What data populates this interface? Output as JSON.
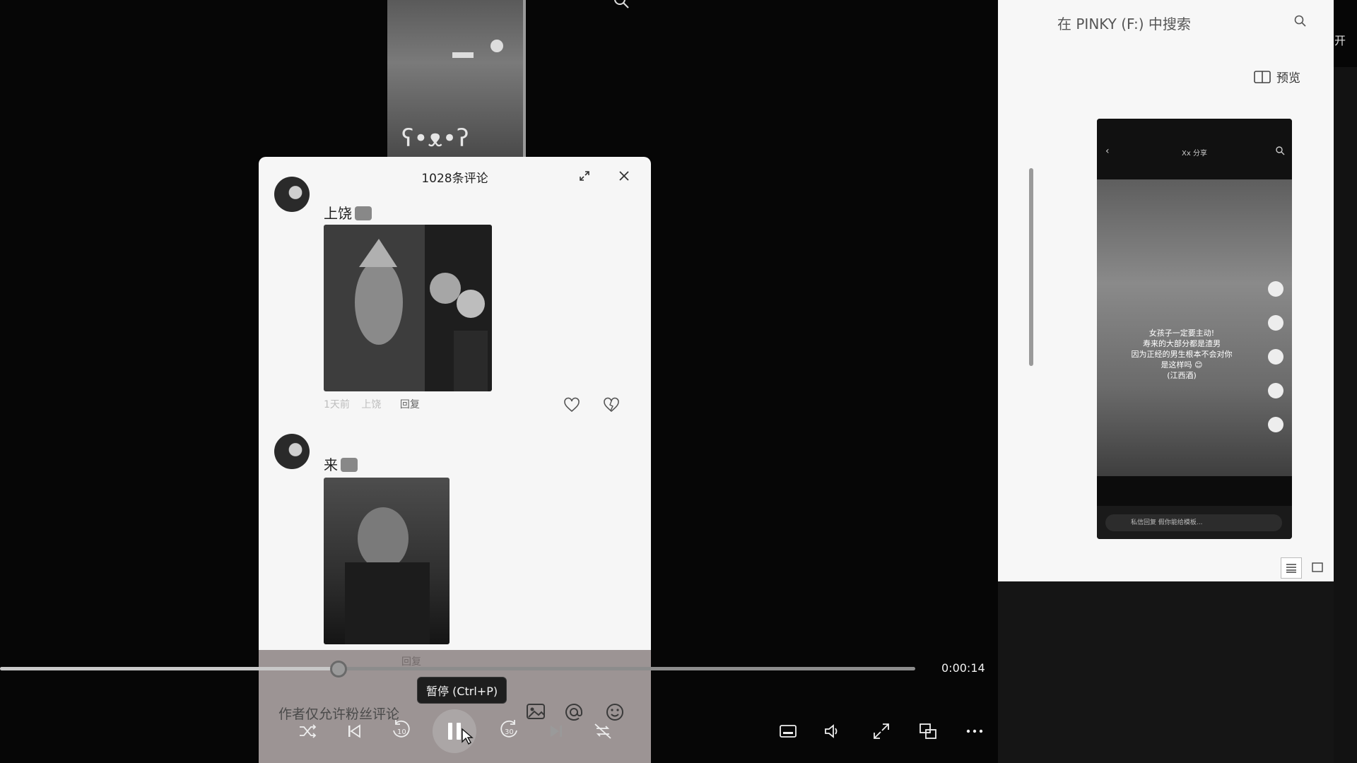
{
  "panel": {
    "title": "1028条评论",
    "comments": [
      {
        "username": "",
        "text": "上饶",
        "meta_time": "1天前",
        "meta_location": "上饶",
        "reply_label": "回复"
      },
      {
        "username": "",
        "text": "来",
        "reply_label": "回复"
      }
    ],
    "author_note": "作者仅允许粉丝评论"
  },
  "player": {
    "time": "0:00:14",
    "progress_fraction": 0.37,
    "tooltip": "暂停 (Ctrl+P)",
    "rewind_label": "10",
    "forward_label": "30"
  },
  "explorer": {
    "search_placeholder": "在 PINKY (F:) 中搜索",
    "preview_label": "预览",
    "edge_text": "开",
    "thumb": {
      "header_title": "Xx 分享",
      "caption": "女孩子一定要主动!\n寿来的大部分都是渣男\n因为正经的男生根本不会对你\n是这样吗 😊\n(江西酒)",
      "input_placeholder": "私信回复 假你能给模板..."
    }
  },
  "icons": {
    "expand": "expand-icon",
    "close": "close-icon",
    "heart": "heart-icon",
    "broken_heart": "dislike-icon",
    "image": "image-icon",
    "at": "at-icon",
    "emoji": "emoji-icon"
  }
}
